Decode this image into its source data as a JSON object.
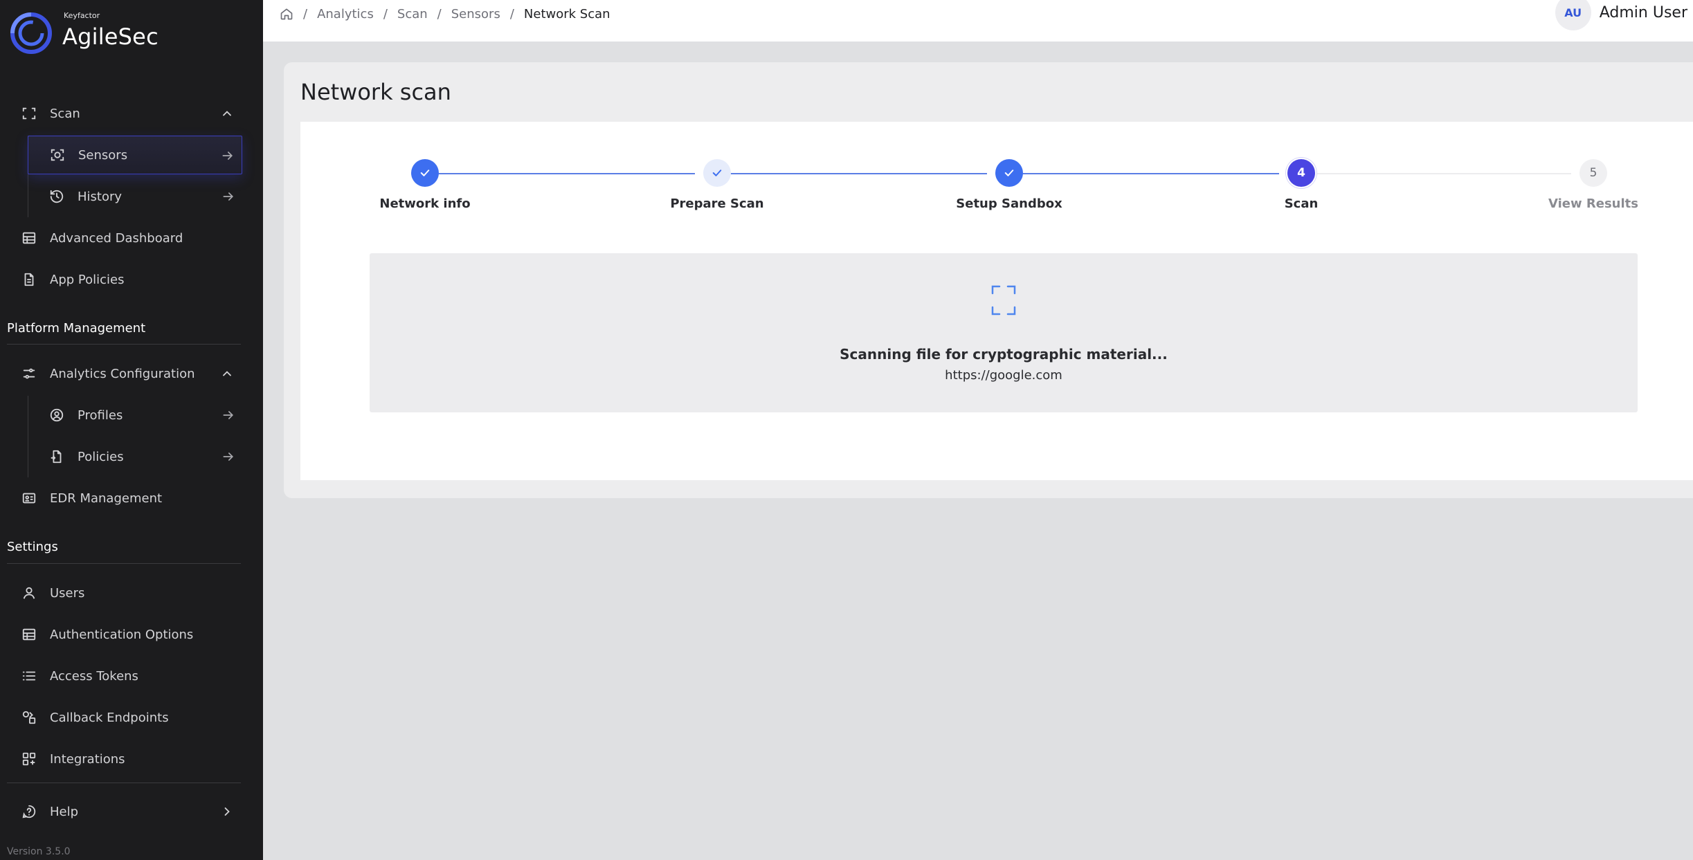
{
  "brand": {
    "small": "Keyfactor",
    "name": "AgileSec"
  },
  "sidebar": {
    "scan": {
      "label": "Scan",
      "icon": "scan-frame-icon"
    },
    "sensors": {
      "label": "Sensors",
      "icon": "sensor-icon"
    },
    "history": {
      "label": "History",
      "icon": "history-icon"
    },
    "advanced_dashboard": {
      "label": "Advanced Dashboard",
      "icon": "dashboard-icon"
    },
    "app_policies": {
      "label": "App Policies",
      "icon": "document-icon"
    },
    "platform_management_title": "Platform Management",
    "analytics_configuration": {
      "label": "Analytics Configuration",
      "icon": "sliders-icon"
    },
    "profiles": {
      "label": "Profiles",
      "icon": "profile-icon"
    },
    "policies": {
      "label": "Policies",
      "icon": "policy-document-icon"
    },
    "edr_management": {
      "label": "EDR Management",
      "icon": "id-card-icon"
    },
    "settings_title": "Settings",
    "users": {
      "label": "Users",
      "icon": "user-icon"
    },
    "authentication_options": {
      "label": "Authentication Options",
      "icon": "table-icon"
    },
    "access_tokens": {
      "label": "Access Tokens",
      "icon": "list-icon"
    },
    "callback_endpoints": {
      "label": "Callback Endpoints",
      "icon": "shapes-icon"
    },
    "integrations": {
      "label": "Integrations",
      "icon": "integrations-icon"
    },
    "help": {
      "label": "Help",
      "icon": "help-icon"
    },
    "version": "Version 3.5.0"
  },
  "breadcrumb": {
    "items": [
      "Analytics",
      "Scan",
      "Sensors"
    ],
    "current": "Network Scan",
    "separator": "/"
  },
  "user": {
    "initials": "AU",
    "name": "Admin User"
  },
  "page": {
    "title": "Network scan"
  },
  "stepper": {
    "steps": [
      {
        "label": "Network info",
        "state": "done"
      },
      {
        "label": "Prepare Scan",
        "state": "done-light"
      },
      {
        "label": "Setup Sandbox",
        "state": "done"
      },
      {
        "label": "Scan",
        "number": "4",
        "state": "active"
      },
      {
        "label": "View Results",
        "number": "5",
        "state": "pending"
      }
    ]
  },
  "scan_status": {
    "title": "Scanning file for cryptographic material...",
    "target": "https://google.com"
  },
  "colors": {
    "sidebar_bg": "#1c1c1e",
    "accent": "#3d6ef0",
    "active_step": "#4a45e2",
    "content_bg": "#dfe0e2"
  }
}
